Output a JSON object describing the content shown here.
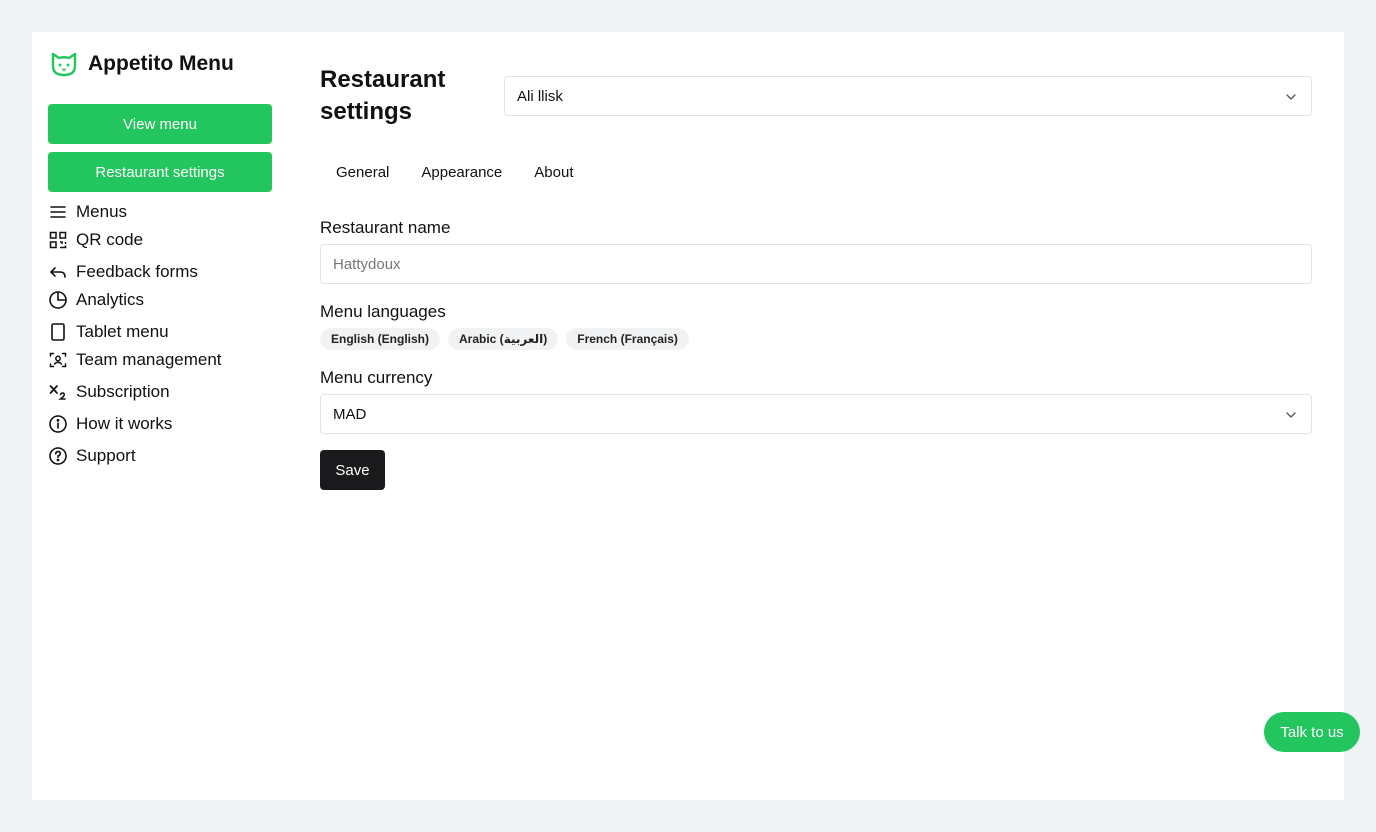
{
  "brand": {
    "name": "Appetito Menu",
    "logo_icon": "cat-face-icon",
    "accent": "#22c55e"
  },
  "sidebar": {
    "view_menu_label": "View menu",
    "restaurant_settings_label": "Restaurant settings",
    "items": [
      {
        "label": "Menus",
        "icon": "hamburger-menu-icon"
      },
      {
        "label": "QR code",
        "icon": "qr-code-icon"
      },
      {
        "label": "Feedback forms",
        "icon": "reply-arrow-icon"
      },
      {
        "label": "Analytics",
        "icon": "pie-chart-icon"
      },
      {
        "label": "Tablet menu",
        "icon": "tablet-icon"
      },
      {
        "label": "Team management",
        "icon": "team-scan-icon"
      },
      {
        "label": "Subscription",
        "icon": "subscript-icon"
      },
      {
        "label": "How it works",
        "icon": "info-icon"
      },
      {
        "label": "Support",
        "icon": "help-circle-icon"
      }
    ]
  },
  "main": {
    "title": "Restaurant settings",
    "user_select": {
      "value": "Ali llisk"
    },
    "tabs": [
      {
        "label": "General"
      },
      {
        "label": "Appearance"
      },
      {
        "label": "About"
      }
    ],
    "form": {
      "restaurant_name_label": "Restaurant name",
      "restaurant_name_placeholder": "Hattydoux",
      "menu_languages_label": "Menu languages",
      "languages": [
        {
          "label": "English (English)"
        },
        {
          "label": "Arabic (العربية)"
        },
        {
          "label": "French (Français)"
        }
      ],
      "menu_currency_label": "Menu currency",
      "currency_value": "MAD",
      "save_label": "Save"
    }
  },
  "floating": {
    "talk_label": "Talk to us"
  },
  "colors": {
    "primary": "#22c55e",
    "dark_button": "#1a1a1c",
    "background": "#f2f3f5"
  }
}
